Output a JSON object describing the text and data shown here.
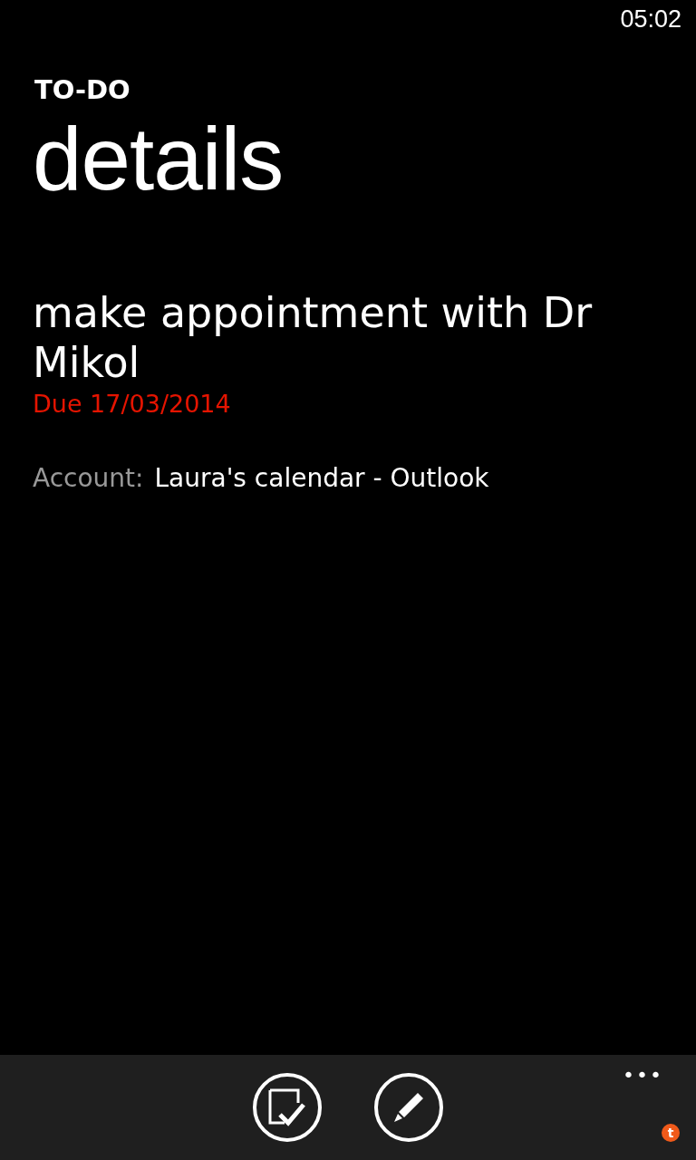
{
  "status_bar": {
    "time": "05:02"
  },
  "app_title": "TO-DO",
  "page_title": "details",
  "task": {
    "title": "make appointment with Dr Mikol",
    "due": "Due 17/03/2014",
    "overdue": true
  },
  "account": {
    "label": "Account:",
    "value": "Laura's calendar - Outlook"
  },
  "app_bar": {
    "buttons": [
      {
        "kind": "complete"
      },
      {
        "kind": "edit"
      }
    ],
    "more": "•••",
    "badge": "t"
  }
}
